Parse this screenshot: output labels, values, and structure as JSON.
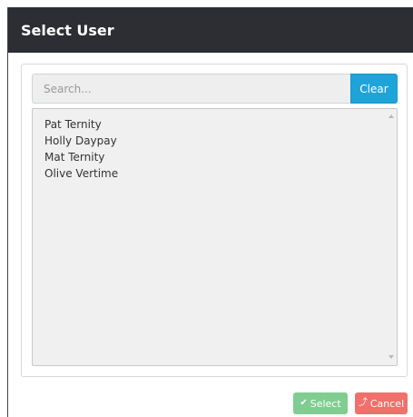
{
  "dialog": {
    "title": "Select User"
  },
  "search": {
    "placeholder": "Search...",
    "value": "",
    "clear_label": "Clear"
  },
  "users": [
    "Pat Ternity",
    "Holly Daypay",
    "Mat Ternity",
    "Olive Vertime"
  ],
  "buttons": {
    "select_label": "Select",
    "select_icon": "checkmark-icon",
    "cancel_label": "Cancel",
    "cancel_icon": "cancel-arrow-icon"
  },
  "colors": {
    "titlebar": "#2c2e33",
    "clear_button": "#1fa4d9",
    "select_button": "#7fcd90",
    "cancel_button": "#f0706b"
  }
}
